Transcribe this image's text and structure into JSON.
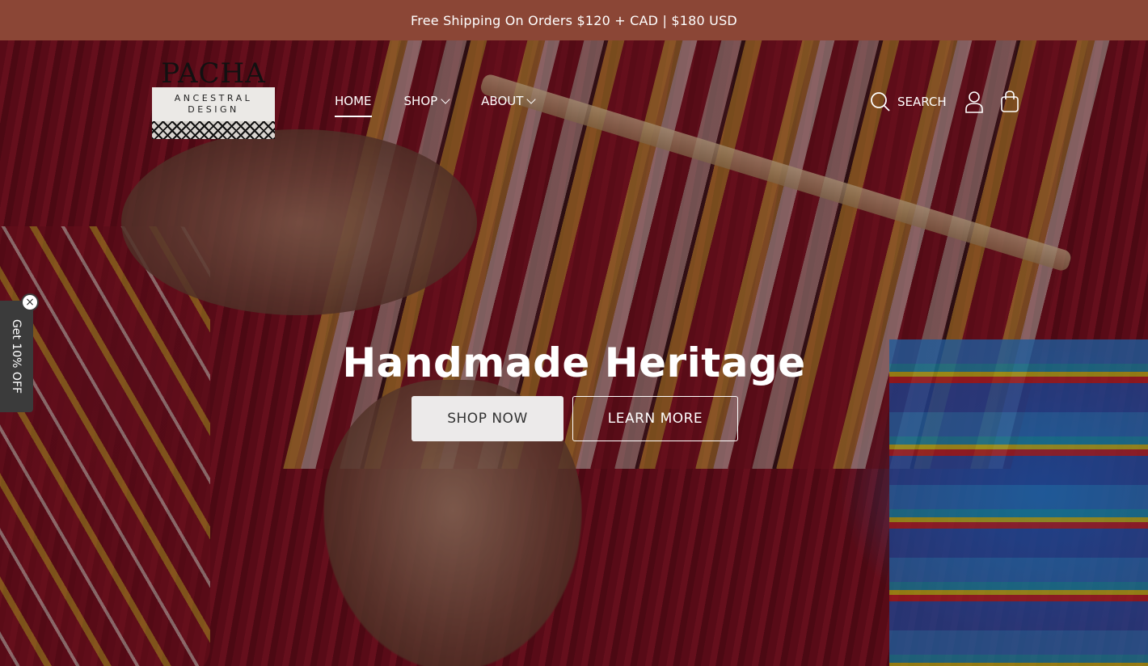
{
  "announcement": "Free Shipping On Orders $120 + CAD | $180 USD",
  "logo": {
    "wordmark": "PACHA",
    "line1": "ANCESTRAL",
    "line2": "DESIGN"
  },
  "nav": {
    "home": "HOME",
    "shop": "SHOP",
    "about": "ABOUT",
    "active": "HOME"
  },
  "tools": {
    "search_label": "SEARCH",
    "icons": [
      "search-icon",
      "account-icon",
      "cart-icon"
    ]
  },
  "hero": {
    "title": "Handmade Heritage",
    "primary_button": "SHOP NOW",
    "secondary_button": "LEARN MORE"
  },
  "promo": {
    "label": "Get 10% OFF",
    "close": "×"
  },
  "colors": {
    "announcement_bg": "#8b4636",
    "promo_bg": "#3b3b3b",
    "button_light": "#eceaea"
  }
}
